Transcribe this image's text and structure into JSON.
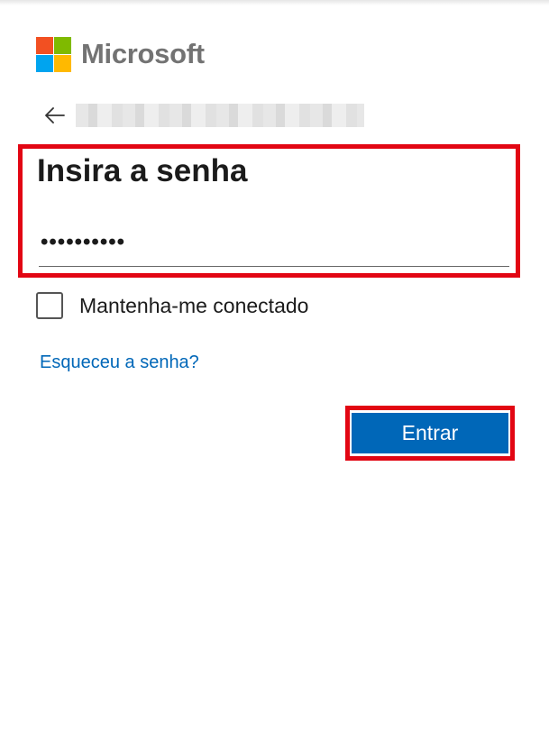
{
  "brand": {
    "name": "Microsoft",
    "colors": [
      "#f25022",
      "#7fba00",
      "#00a4ef",
      "#ffb900"
    ]
  },
  "back": {
    "icon": "back-arrow-icon"
  },
  "form": {
    "title": "Insira a senha",
    "password_value": "••••••••••",
    "keep_signed_in_label": "Mantenha-me conectado",
    "keep_signed_in_checked": false,
    "forgot_link": "Esqueceu a senha?",
    "submit_label": "Entrar"
  },
  "colors": {
    "accent": "#0067b8",
    "highlight": "#e20613",
    "text": "#1b1b1b",
    "logo_text": "#737373"
  }
}
